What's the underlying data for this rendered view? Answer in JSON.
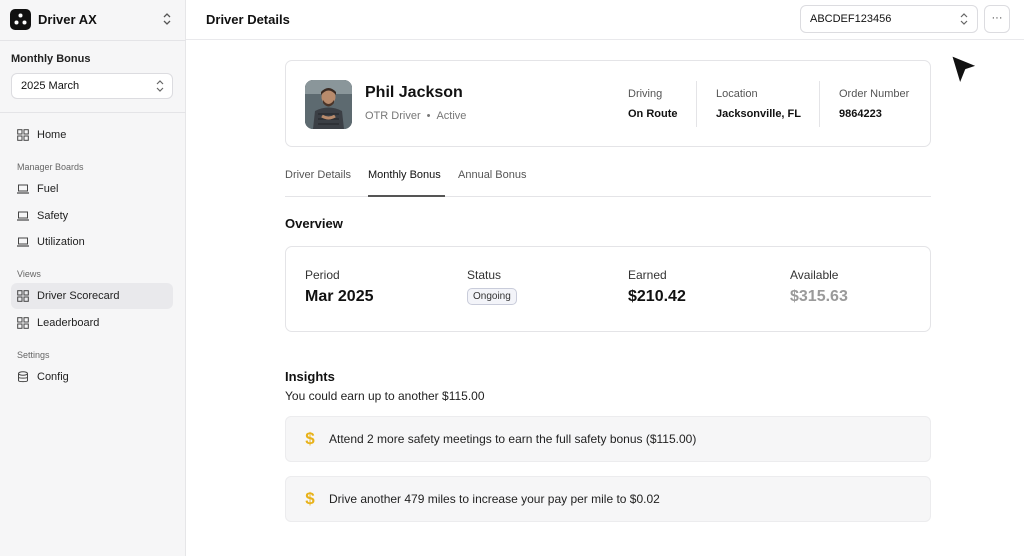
{
  "app": {
    "name": "Driver AX"
  },
  "sidebar": {
    "monthly_bonus_label": "Monthly Bonus",
    "period_select": "2025 March",
    "home": "Home",
    "section_manager": "Manager Boards",
    "manager_items": [
      "Fuel",
      "Safety",
      "Utilization"
    ],
    "section_views": "Views",
    "view_items": [
      "Driver Scorecard",
      "Leaderboard"
    ],
    "section_settings": "Settings",
    "settings_items": [
      "Config"
    ]
  },
  "header": {
    "title": "Driver Details",
    "id_select": "ABCDEF123456",
    "more_label": "···"
  },
  "driver": {
    "name": "Phil Jackson",
    "role": "OTR Driver",
    "separator": "•",
    "status": "Active",
    "stats": [
      {
        "label": "Driving",
        "value": "On Route"
      },
      {
        "label": "Location",
        "value": "Jacksonville, FL"
      },
      {
        "label": "Order Number",
        "value": "9864223"
      }
    ]
  },
  "tabs": [
    "Driver Details",
    "Monthly Bonus",
    "Annual Bonus"
  ],
  "overview": {
    "title": "Overview",
    "period_label": "Period",
    "period_value": "Mar 2025",
    "status_label": "Status",
    "status_value": "Ongoing",
    "earned_label": "Earned",
    "earned_value": "$210.42",
    "available_label": "Available",
    "available_value": "$315.63"
  },
  "insights": {
    "title": "Insights",
    "subtitle": "You could earn up to another $115.00",
    "icon": "$",
    "items": [
      "Attend 2 more safety meetings to earn the full safety bonus ($115.00)",
      "Drive another 479 miles to increase your pay per mile to $0.02"
    ]
  },
  "colors": {
    "accent_gold": "#e8b21a",
    "active_tab_underline": "#555555"
  }
}
